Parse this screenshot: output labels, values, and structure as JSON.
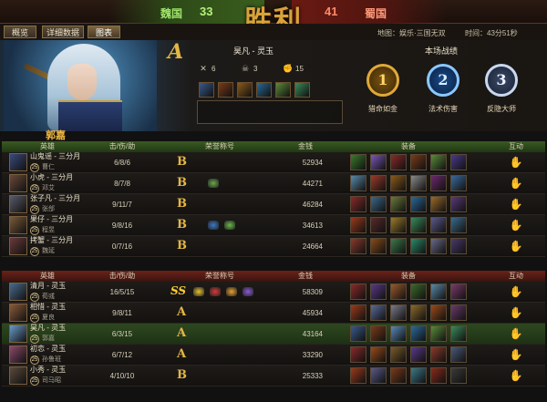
{
  "header": {
    "left_team": "魏国",
    "left_score": "33",
    "center_title": "胜利",
    "right_score": "41",
    "right_team": "蜀国"
  },
  "tabs": [
    {
      "label": "概览"
    },
    {
      "label": "详细数据"
    },
    {
      "label": "图表"
    }
  ],
  "map_info": "地图：娱乐·三国无双",
  "time_info": "时间：43分51秒",
  "banner": {
    "grade": "A",
    "hero_name": "昊凡 - 灵玉",
    "kills": "6",
    "deaths": "3",
    "assists": "15",
    "battle_title": "本场战绩",
    "medals": [
      {
        "num": "1",
        "label": "猎命如金"
      },
      {
        "num": "2",
        "label": "法术伤害"
      },
      {
        "num": "3",
        "label": "反隐大师"
      }
    ],
    "player_name": "郭嘉",
    "item_colors": [
      "#3a5a8a",
      "#7a3a1a",
      "#8a5a1a",
      "#2a6a9a",
      "#5a8a3a",
      "#3a8a5a"
    ]
  },
  "table_headers": {
    "hero": "英雄",
    "kda": "击/伤/助",
    "honor": "荣誉称号",
    "gold": "金钱",
    "equip": "装备",
    "interact": "互动"
  },
  "team_top": [
    {
      "hero": "山鬼谣 - 三分月",
      "level": "25",
      "player": "曹仁",
      "kda": "6/8/6",
      "grade": "B",
      "gold": "52934",
      "avatar": "#3a4a7a",
      "badges": [],
      "items": [
        "#3a7a2a",
        "#7a5ab8",
        "#8a2a2a",
        "#7a3a1a",
        "#5a8a3a",
        "#4a3a8a"
      ]
    },
    {
      "hero": "小虎 - 三分月",
      "level": "25",
      "player": "邓艾",
      "kda": "8/7/8",
      "grade": "B",
      "gold": "44271",
      "avatar": "#6a4a3a",
      "badges": [
        "#6aa84a"
      ],
      "items": [
        "#5a8aa8",
        "#9a3a2a",
        "#8a5a1a",
        "#8a8a8a",
        "#6a2a6a",
        "#3a6a9a"
      ]
    },
    {
      "hero": "张子凡 - 三分月",
      "level": "25",
      "player": "张郃",
      "kda": "9/11/7",
      "grade": "B",
      "gold": "46284",
      "avatar": "#5a5a6a",
      "badges": [],
      "items": [
        "#8a2a2a",
        "#3a6a8a",
        "#6a7a3a",
        "#2a6a9a",
        "#9a6a2a",
        "#5a3a7a"
      ]
    },
    {
      "hero": "果仔 - 三分月",
      "level": "25",
      "player": "程昱",
      "kda": "9/8/16",
      "grade": "B",
      "gold": "34613",
      "avatar": "#7a5a3a",
      "badges": [
        "#3a7ac8",
        "#6ab84a"
      ],
      "items": [
        "#9a3a1a",
        "#5a2a2a",
        "#9a7a2a",
        "#3a8a5a",
        "#5a5a8a",
        "#3a6a8a"
      ]
    },
    {
      "hero": "拷蟹 - 三分月",
      "level": "25",
      "player": "魏延",
      "kda": "0/7/16",
      "grade": "B",
      "gold": "24664",
      "avatar": "#6a3a3a",
      "badges": [],
      "items": [
        "#8a3a2a",
        "#8a4a1a",
        "#3a7a4a",
        "#2a8a6a",
        "#6a6a8a",
        "#4a3a6a"
      ]
    }
  ],
  "team_bottom": [
    {
      "hero": "清月 - 灵玉",
      "level": "25",
      "player": "荀彧",
      "kda": "16/5/15",
      "grade": "SS",
      "gold": "58309",
      "avatar": "#4a6a8a",
      "highlight": false,
      "badges": [
        "#e8c030",
        "#d83a3a",
        "#e8a030",
        "#8a5ad8"
      ],
      "items": [
        "#8a2a2a",
        "#5a3a8a",
        "#9a5a2a",
        "#3a6a2a",
        "#5a8aa8",
        "#7a3a6a"
      ]
    },
    {
      "hero": "相惜 - 灵玉",
      "level": "25",
      "player": "夏良",
      "kda": "9/8/11",
      "grade": "A",
      "gold": "45934",
      "avatar": "#8a5a3a",
      "highlight": false,
      "badges": [],
      "items": [
        "#9a3a1a",
        "#5a6a9a",
        "#7a7a8a",
        "#8a6a2a",
        "#9a4a1a",
        "#6a3a6a"
      ]
    },
    {
      "hero": "昊凡 - 灵玉",
      "level": "25",
      "player": "郭嘉",
      "kda": "6/3/15",
      "grade": "A",
      "gold": "43164",
      "avatar": "#6a9ac8",
      "highlight": true,
      "badges": [],
      "items": [
        "#3a5a8a",
        "#7a3a1a",
        "#5a8ab8",
        "#2a6a9a",
        "#5a8a3a",
        "#3a8a5a"
      ]
    },
    {
      "hero": "初恋 - 灵玉",
      "level": "25",
      "player": "孙鲁班",
      "kda": "6/7/12",
      "grade": "A",
      "gold": "33290",
      "avatar": "#8a4a6a",
      "highlight": false,
      "badges": [],
      "items": [
        "#8a2a2a",
        "#9a4a1a",
        "#7a5a2a",
        "#5a3a8a",
        "#8a3a2a",
        "#4a5a7a"
      ]
    },
    {
      "hero": "小秀 - 灵玉",
      "level": "25",
      "player": "司马昭",
      "kda": "4/10/10",
      "grade": "B",
      "gold": "25333",
      "avatar": "#5a4a3a",
      "highlight": false,
      "badges": [],
      "items": [
        "#9a3a1a",
        "#5a5a8a",
        "#7a3a1a",
        "#3a7a8a",
        "#8a2a1a",
        "#3a3a3a"
      ]
    }
  ]
}
